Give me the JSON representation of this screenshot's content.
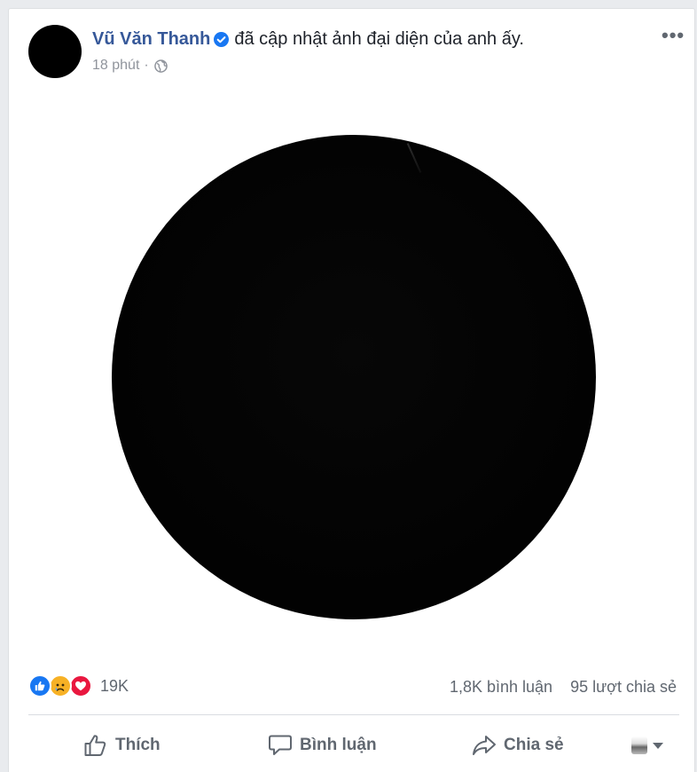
{
  "post": {
    "author": "Vũ Văn Thanh",
    "action_text": "đã cập nhật ảnh đại diện của anh ấy.",
    "time": "18 phút",
    "separator": "·",
    "more_label": "•••"
  },
  "reactions": {
    "types": [
      "like-icon",
      "sad-icon",
      "love-icon"
    ],
    "count": "19K"
  },
  "stats": {
    "comments": "1,8K bình luận",
    "shares": "95 lượt chia sẻ"
  },
  "actions": {
    "like": "Thích",
    "comment": "Bình luận",
    "share": "Chia sẻ"
  },
  "colors": {
    "author_link": "#365899",
    "like_blue": "#1877f2",
    "love_red": "#e9173f",
    "sad_yellow": "#f7b125",
    "muted_text": "#606770"
  }
}
